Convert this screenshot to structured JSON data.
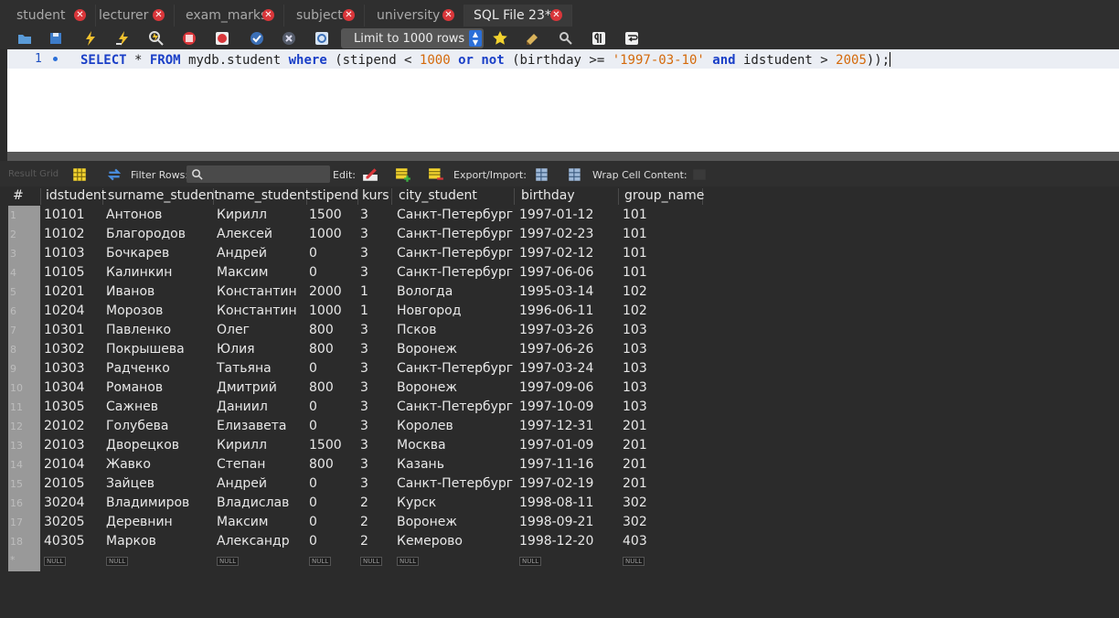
{
  "tabs": [
    {
      "label": "student"
    },
    {
      "label": "lecturer"
    },
    {
      "label": "exam_marks"
    },
    {
      "label": "subject"
    },
    {
      "label": "university"
    },
    {
      "label": "SQL File 23*"
    }
  ],
  "toolbar": {
    "limit_label": "Limit to 1000 rows",
    "icons": [
      "open-file-icon",
      "save-icon",
      "execute-icon",
      "execute-current-icon",
      "explain-icon",
      "stop-icon",
      "toggle-continue-icon",
      "commit-icon",
      "rollback-icon",
      "autocommit-icon",
      "limit-select",
      "bookmark-star-icon",
      "beautify-icon",
      "find-icon",
      "invisible-chars-icon",
      "wrap-icon"
    ]
  },
  "editor": {
    "line_number": "1",
    "sql_tokens": [
      {
        "t": "SELECT",
        "c": "kw"
      },
      {
        "t": " * ",
        "c": ""
      },
      {
        "t": "FROM",
        "c": "kw"
      },
      {
        "t": " mydb.student ",
        "c": ""
      },
      {
        "t": "where",
        "c": "kw"
      },
      {
        "t": " (stipend < ",
        "c": ""
      },
      {
        "t": "1000",
        "c": "num"
      },
      {
        "t": " ",
        "c": ""
      },
      {
        "t": "or",
        "c": "kw"
      },
      {
        "t": " ",
        "c": ""
      },
      {
        "t": "not",
        "c": "kw"
      },
      {
        "t": " (birthday >= ",
        "c": ""
      },
      {
        "t": "'1997-03-10'",
        "c": "str"
      },
      {
        "t": " ",
        "c": ""
      },
      {
        "t": "and",
        "c": "kw"
      },
      {
        "t": " idstudent > ",
        "c": ""
      },
      {
        "t": "2005",
        "c": "num"
      },
      {
        "t": "));",
        "c": ""
      }
    ]
  },
  "result_toolbar": {
    "result_grid_label": "Result Grid",
    "filter_label": "Filter Rows:",
    "edit_label": "Edit:",
    "export_label": "Export/Import:",
    "wrap_label": "Wrap Cell Content:"
  },
  "grid": {
    "row_number_header": "#",
    "columns": [
      "idstudent",
      "surname_student",
      "name_student",
      "stipend",
      "kurs",
      "city_student",
      "birthday",
      "group_name"
    ],
    "rows": [
      [
        "10101",
        "Антонов",
        "Кирилл",
        "1500",
        "3",
        "Санкт-Петербург",
        "1997-01-12",
        "101"
      ],
      [
        "10102",
        "Благородов",
        "Алексей",
        "1000",
        "3",
        "Санкт-Петербург",
        "1997-02-23",
        "101"
      ],
      [
        "10103",
        "Бочкарев",
        "Андрей",
        "0",
        "3",
        "Санкт-Петербург",
        "1997-02-12",
        "101"
      ],
      [
        "10105",
        "Калинкин",
        "Максим",
        "0",
        "3",
        "Санкт-Петербург",
        "1997-06-06",
        "101"
      ],
      [
        "10201",
        "Иванов",
        "Константин",
        "2000",
        "1",
        "Вологда",
        "1995-03-14",
        "102"
      ],
      [
        "10204",
        "Морозов",
        "Константин",
        "1000",
        "1",
        "Новгород",
        "1996-06-11",
        "102"
      ],
      [
        "10301",
        "Павленко",
        "Олег",
        "800",
        "3",
        "Псков",
        "1997-03-26",
        "103"
      ],
      [
        "10302",
        "Покрышева",
        "Юлия",
        "800",
        "3",
        "Воронеж",
        "1997-06-26",
        "103"
      ],
      [
        "10303",
        "Радченко",
        "Татьяна",
        "0",
        "3",
        "Санкт-Петербург",
        "1997-03-24",
        "103"
      ],
      [
        "10304",
        "Романов",
        "Дмитрий",
        "800",
        "3",
        "Воронеж",
        "1997-09-06",
        "103"
      ],
      [
        "10305",
        "Сажнев",
        "Даниил",
        "0",
        "3",
        "Санкт-Петербург",
        "1997-10-09",
        "103"
      ],
      [
        "20102",
        "Голубева",
        "Елизавета",
        "0",
        "3",
        "Королев",
        "1997-12-31",
        "201"
      ],
      [
        "20103",
        "Дворецков",
        "Кирилл",
        "1500",
        "3",
        "Москва",
        "1997-01-09",
        "201"
      ],
      [
        "20104",
        "Жавко",
        "Степан",
        "800",
        "3",
        "Казань",
        "1997-11-16",
        "201"
      ],
      [
        "20105",
        "Зайцев",
        "Андрей",
        "0",
        "3",
        "Санкт-Петербург",
        "1997-02-19",
        "201"
      ],
      [
        "30204",
        "Владимиров",
        "Владислав",
        "0",
        "2",
        "Курск",
        "1998-08-11",
        "302"
      ],
      [
        "30205",
        "Деревнин",
        "Максим",
        "0",
        "2",
        "Воронеж",
        "1998-09-21",
        "302"
      ],
      [
        "40305",
        "Марков",
        "Александр",
        "0",
        "2",
        "Кемерово",
        "1998-12-20",
        "403"
      ]
    ],
    "row_numbers": [
      "1",
      "2",
      "3",
      "4",
      "5",
      "6",
      "7",
      "8",
      "9",
      "10",
      "11",
      "12",
      "13",
      "14",
      "15",
      "16",
      "17",
      "18"
    ],
    "new_row_marker": "*",
    "null_label": "NULL"
  }
}
